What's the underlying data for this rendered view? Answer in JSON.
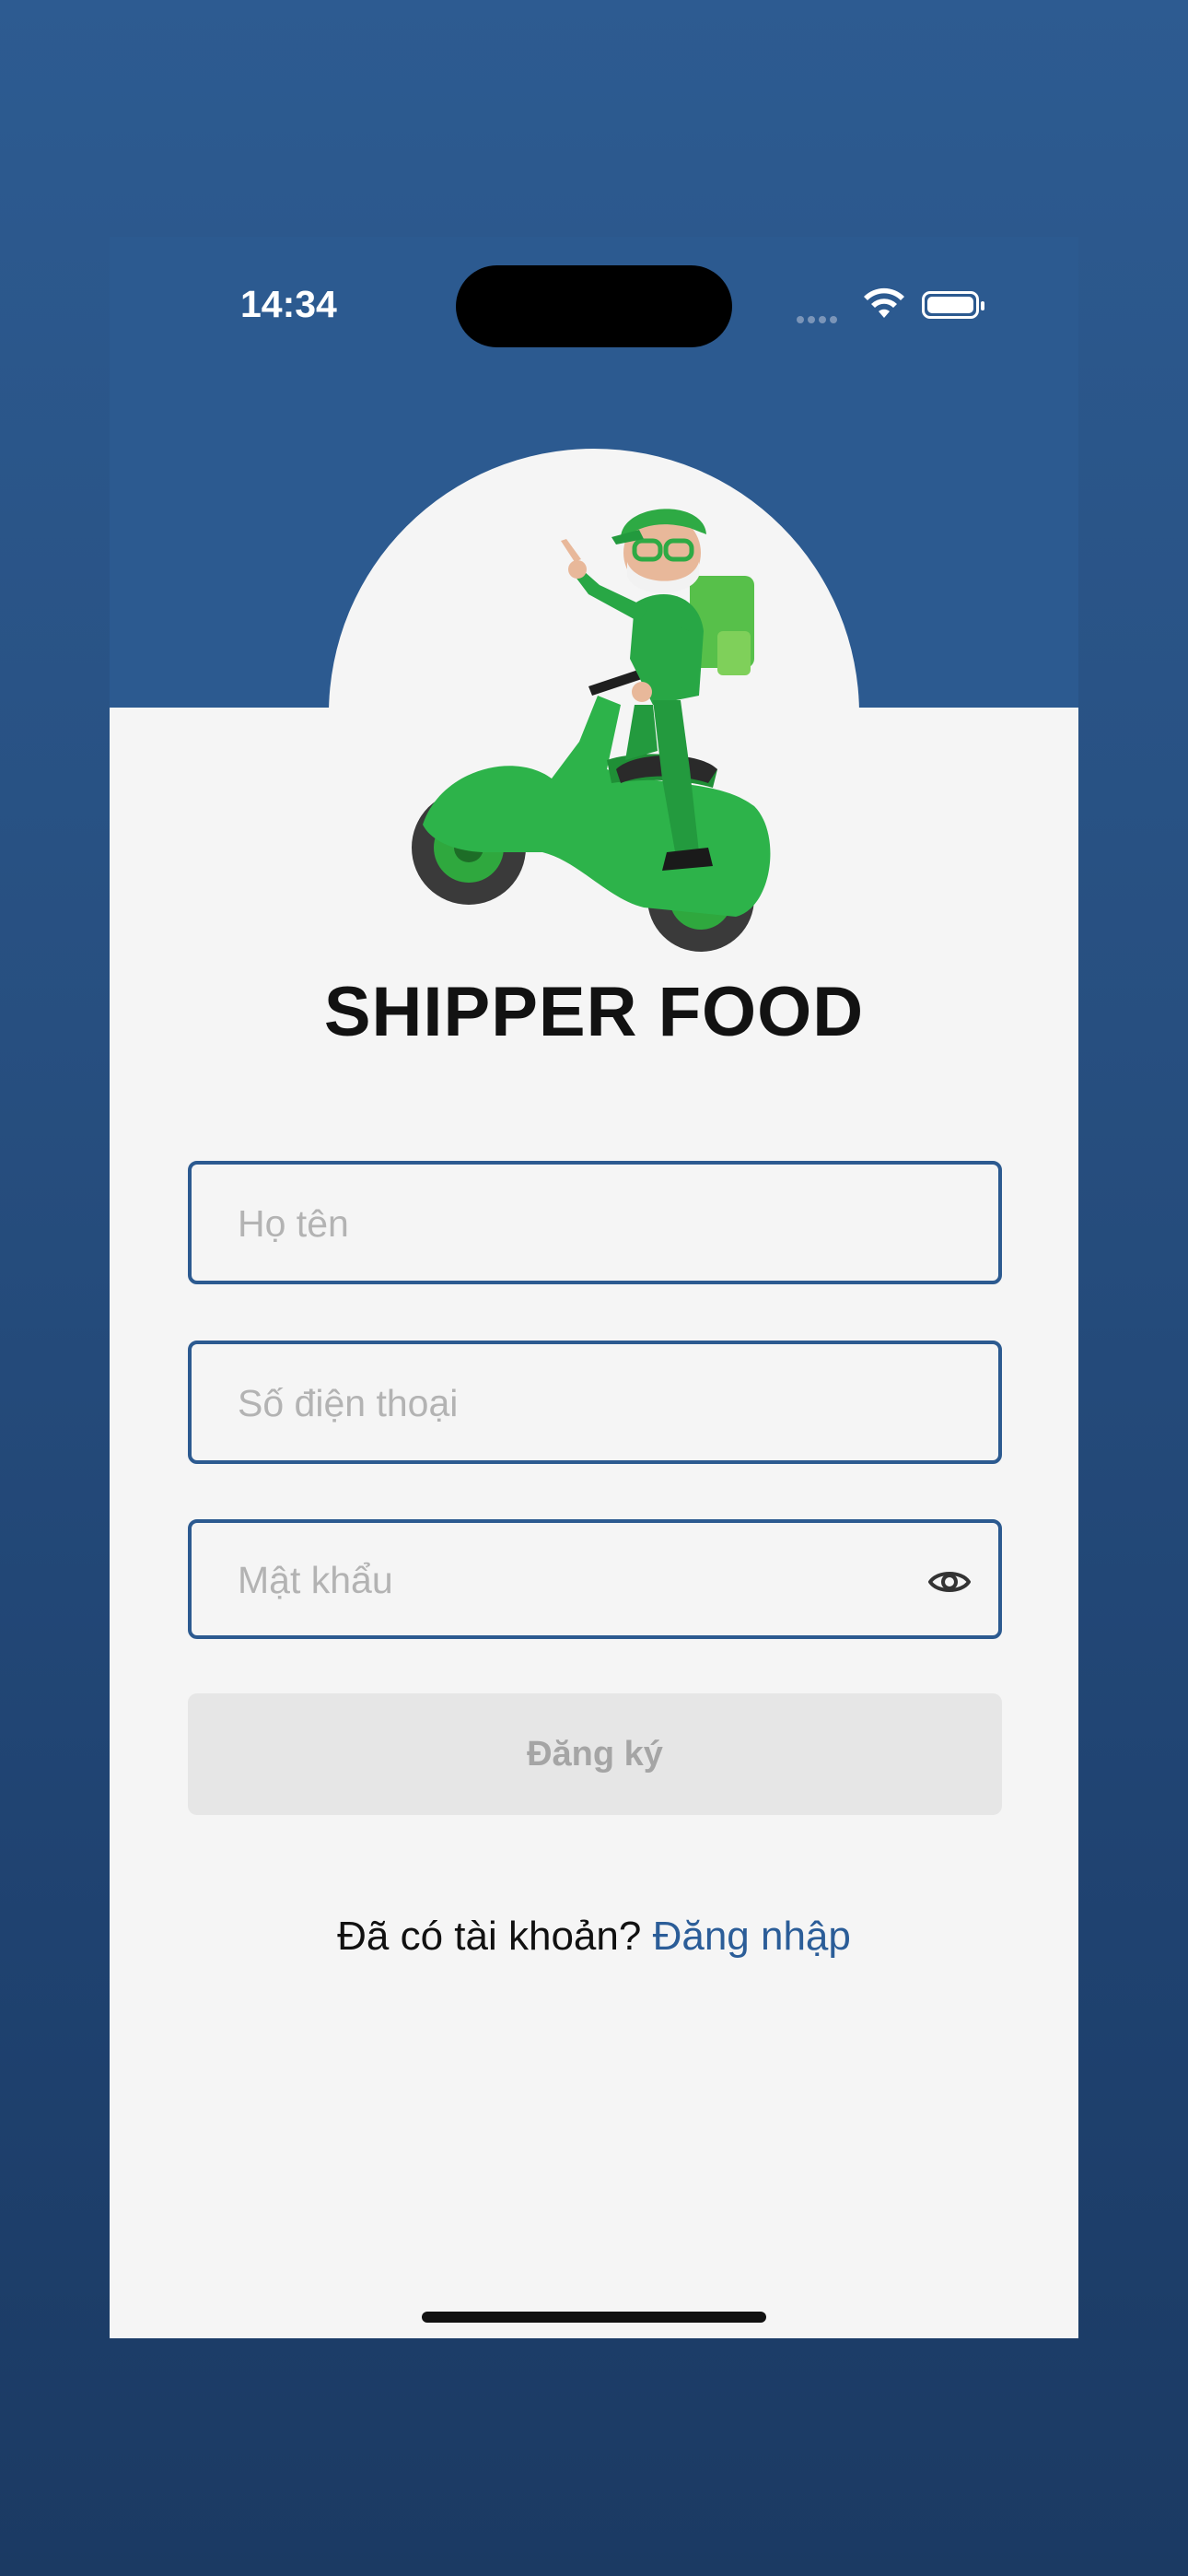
{
  "status_bar": {
    "time": "14:34"
  },
  "app": {
    "title": "SHIPPER FOOD"
  },
  "form": {
    "name_placeholder": "Họ tên",
    "phone_placeholder": "Số điện thoại",
    "password_placeholder": "Mật khẩu",
    "register_label": "Đăng ký"
  },
  "footer": {
    "prompt": "Đã có tài khoản?",
    "login_link": "Đăng nhập"
  },
  "colors": {
    "primary": "#2c5a90",
    "button_disabled_bg": "#e6e6e6",
    "link": "#2b5d98"
  },
  "icons": [
    "wifi-icon",
    "battery-icon",
    "eye-icon",
    "shipper-mascot"
  ]
}
